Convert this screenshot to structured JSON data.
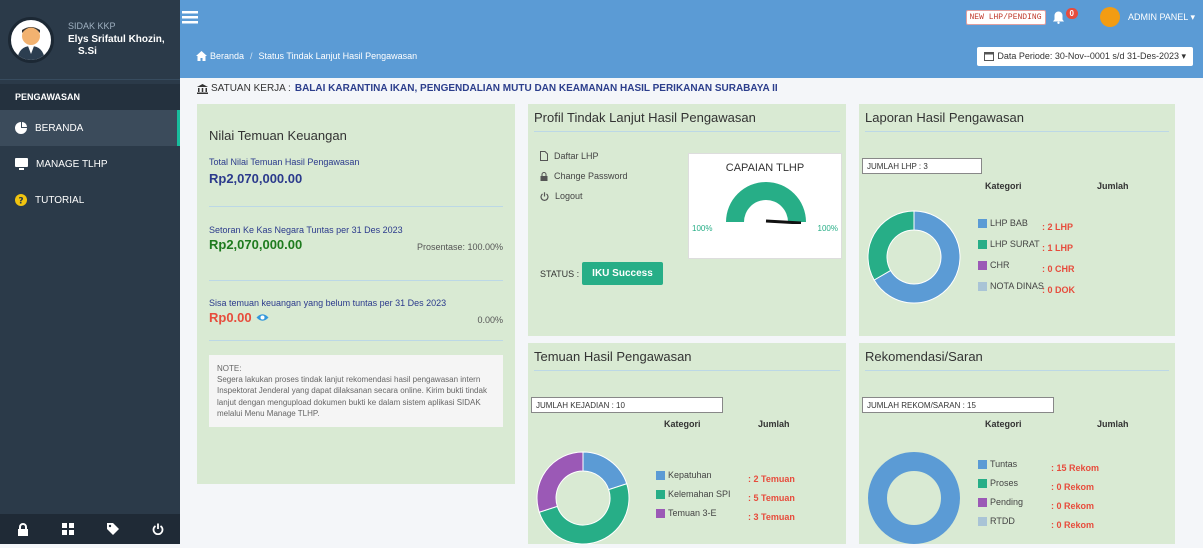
{
  "sidebar": {
    "app_name": "SIDAK KKP",
    "user_name": "Elys Srifatul Khozin,",
    "user_title": "S.Si",
    "section": "PENGAWASAN",
    "items": [
      {
        "label": "BERANDA"
      },
      {
        "label": "MANAGE TLHP"
      },
      {
        "label": "TUTORIAL"
      }
    ]
  },
  "topbar": {
    "pending_label": "NEW LHP/PENDING",
    "notif_count": "0",
    "admin_label": "ADMIN PANEL ▾"
  },
  "breadcrumb": {
    "home": "Beranda",
    "separator": "/",
    "current": "Status Tindak Lanjut Hasil Pengawasan"
  },
  "period": "Data Periode: 30-Nov--0001 s/d 31-Des-2023 ▾",
  "satker": {
    "label": "SATUAN KERJA :",
    "value": "BALAI KARANTINA IKAN, PENGENDALIAN MUTU DAN KEAMANAN HASIL PERIKANAN SURABAYA II"
  },
  "nilai": {
    "title": "Nilai Temuan Keuangan",
    "total_label": "Total Nilai Temuan Hasil Pengawasan",
    "total_value": "Rp2,070,000.00",
    "setoran_label": "Setoran Ke Kas Negara Tuntas per 31 Des 2023",
    "setoran_value": "Rp2,070,000.00",
    "setoran_pct": "Prosentase: 100.00%",
    "sisa_label": "Sisa temuan keuangan yang belum tuntas per 31 Des 2023",
    "sisa_value": "Rp0.00",
    "sisa_pct": "0.00%",
    "note_title": "NOTE:",
    "note_text": "Segera lakukan proses tindak lanjut rekomendasi hasil pengawasan intern Inspektorat Jenderal yang dapat dilaksanan secara online. Kirim bukti tindak lanjut dengan mengupload dokumen bukti ke dalam sistem aplikasi SIDAK melalui Menu Manage TLHP."
  },
  "profil": {
    "title": "Profil Tindak Lanjut Hasil Pengawasan",
    "links": [
      "Daftar LHP",
      "Change Password",
      "Logout"
    ],
    "gauge_title": "CAPAIAN TLHP",
    "gauge_min": "100%",
    "gauge_max": "100%",
    "status_label": "STATUS :",
    "status_button": "IKU Success"
  },
  "laporan": {
    "title": "Laporan Hasil Pengawasan",
    "count": "JUMLAH LHP : 3",
    "kategori": "Kategori",
    "jumlah": "Jumlah",
    "items": [
      {
        "label": "LHP BAB",
        "value": "2 LHP",
        "color": "#5b9bd5",
        "n": 2
      },
      {
        "label": "LHP SURAT",
        "value": "1 LHP",
        "color": "#27ae87",
        "n": 1
      },
      {
        "label": "CHR",
        "value": "0 CHR",
        "color": "#9b59b6",
        "n": 0
      },
      {
        "label": "NOTA DINAS",
        "value": "0 DOK",
        "color": "#a9c4d6",
        "n": 0
      }
    ]
  },
  "temuan": {
    "title": "Temuan Hasil Pengawasan",
    "count": "JUMLAH KEJADIAN : 10",
    "kategori": "Kategori",
    "jumlah": "Jumlah",
    "items": [
      {
        "label": "Kepatuhan",
        "value": "2 Temuan",
        "color": "#5b9bd5",
        "n": 2
      },
      {
        "label": "Kelemahan SPI",
        "value": "5 Temuan",
        "color": "#27ae87",
        "n": 5
      },
      {
        "label": "Temuan 3-E",
        "value": "3 Temuan",
        "color": "#9b59b6",
        "n": 3
      }
    ]
  },
  "rekom": {
    "title": "Rekomendasi/Saran",
    "count": "JUMLAH REKOM/SARAN : 15",
    "kategori": "Kategori",
    "jumlah": "Jumlah",
    "items": [
      {
        "label": "Tuntas",
        "value": "15 Rekom",
        "color": "#5b9bd5",
        "n": 15
      },
      {
        "label": "Proses",
        "value": "0 Rekom",
        "color": "#27ae87",
        "n": 0
      },
      {
        "label": "Pending",
        "value": "0 Rekom",
        "color": "#9b59b6",
        "n": 0
      },
      {
        "label": "RTDD",
        "value": "0 Rekom",
        "color": "#a9c4d6",
        "n": 0
      }
    ]
  }
}
